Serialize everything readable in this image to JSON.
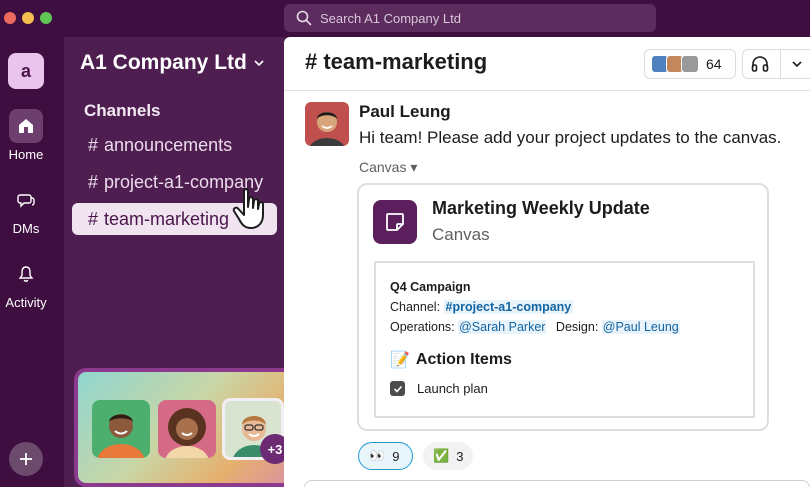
{
  "titlebar": {
    "search_placeholder": "Search A1 Company Ltd"
  },
  "rail": {
    "workspace_initial": "a",
    "items": [
      {
        "label": "Home",
        "icon": "home-icon"
      },
      {
        "label": "DMs",
        "icon": "dms-icon"
      },
      {
        "label": "Activity",
        "icon": "bell-icon"
      }
    ],
    "add_icon": "plus-icon"
  },
  "sidebar": {
    "workspace_name": "A1 Company Ltd",
    "section_title": "Channels",
    "channels": [
      {
        "hash": "#",
        "name": "announcements"
      },
      {
        "hash": "#",
        "name": "project-a1-company"
      },
      {
        "hash": "#",
        "name": "team-marketing"
      }
    ],
    "huddle": {
      "extra_count": "+3"
    }
  },
  "header": {
    "channel_title": "# team-marketing",
    "member_count": "64"
  },
  "message": {
    "sender": "Paul Leung",
    "text": "Hi team! Please add your project updates to the canvas.",
    "canvas_label": "Canvas ▾"
  },
  "canvas": {
    "title": "Marketing Weekly Update",
    "subtitle": "Canvas",
    "preview": {
      "heading": "Q4 Campaign",
      "channel_label": "Channel: ",
      "channel_link": "#project-a1-company",
      "operations_label": "Operations: ",
      "operations_mention": "@Sarah Parker",
      "design_label": "Design: ",
      "design_mention": "@Paul Leung",
      "action_emoji": "📝",
      "action_title": "Action Items",
      "task": "Launch plan"
    }
  },
  "reactions": [
    {
      "emoji": "👀",
      "count": "9"
    },
    {
      "emoji": "✅",
      "count": "3"
    }
  ],
  "colors": {
    "aubergine": "#4a154b",
    "sidebar": "#4f1e51",
    "link": "#1264a3"
  }
}
